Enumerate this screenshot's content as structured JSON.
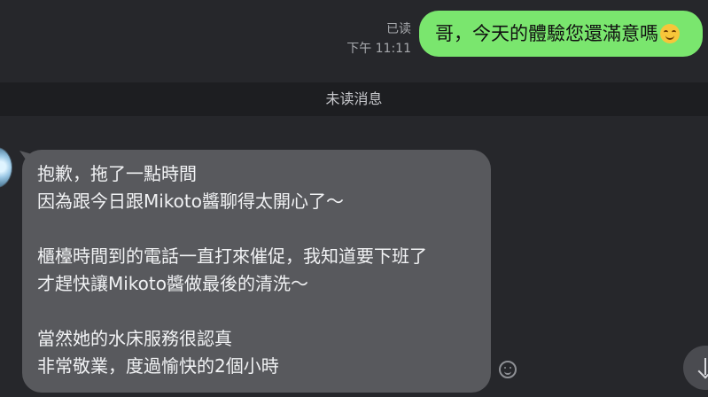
{
  "outgoing_message": {
    "read_status": "已读",
    "time": "下午 11:11",
    "text": "哥，今天的體驗您還滿意嗎",
    "emoji_icon": "smiling-face-emoji"
  },
  "unread_divider": {
    "label": "未读消息"
  },
  "incoming_message": {
    "lines": [
      "抱歉，拖了一點時間",
      "因為跟今日跟Mikoto醬聊得太開心了～",
      "",
      "櫃檯時間到的電話一直打來催促，我知道要下班了",
      "才趕快讓Mikoto醬做最後的清洗～",
      "",
      "當然她的水床服務很認真",
      "非常敬業，度過愉快的2個小時"
    ]
  },
  "controls": {
    "emoji_reaction_icon": "emoji-reaction-icon",
    "scroll_down_icon": "arrow-down-icon"
  },
  "colors": {
    "background": "#26272b",
    "outgoing_bubble": "#7ae66e",
    "incoming_bubble": "#58595d",
    "divider_bar": "#1d1e21"
  }
}
